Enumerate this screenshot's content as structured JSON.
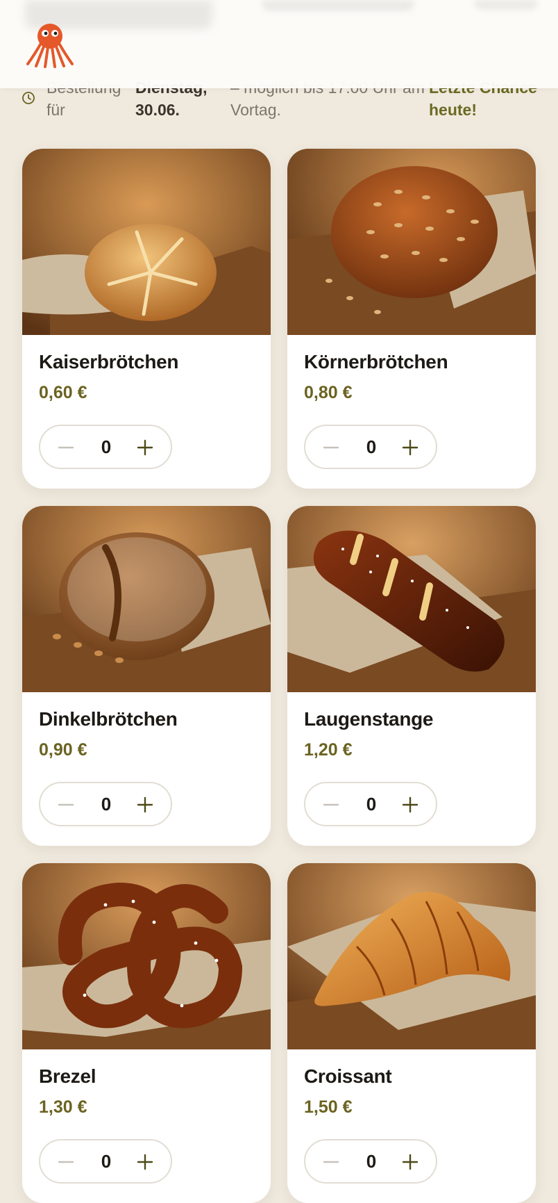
{
  "header": {
    "logo_icon": "octopus-logo-icon"
  },
  "banner": {
    "icon": "clock-icon",
    "label": "Bestellung für",
    "date": "Dienstag, 30.06.",
    "note": "– möglich bis 17:00 Uhr am Vortag.",
    "deadline": "Letzte Chance heute!"
  },
  "products": [
    {
      "name": "Kaiserbrötchen",
      "price": "0,60 €",
      "qty": "0"
    },
    {
      "name": "Körnerbrötchen",
      "price": "0,80 €",
      "qty": "0"
    },
    {
      "name": "Dinkelbrötchen",
      "price": "0,90 €",
      "qty": "0"
    },
    {
      "name": "Laugenstange",
      "price": "1,20 €",
      "qty": "0"
    },
    {
      "name": "Brezel",
      "price": "1,30 €",
      "qty": "0"
    },
    {
      "name": "Croissant",
      "price": "1,50 €",
      "qty": "0"
    }
  ],
  "colors": {
    "accent": "#6b6321",
    "logo": "#e4582a",
    "background": "#efe9de"
  }
}
